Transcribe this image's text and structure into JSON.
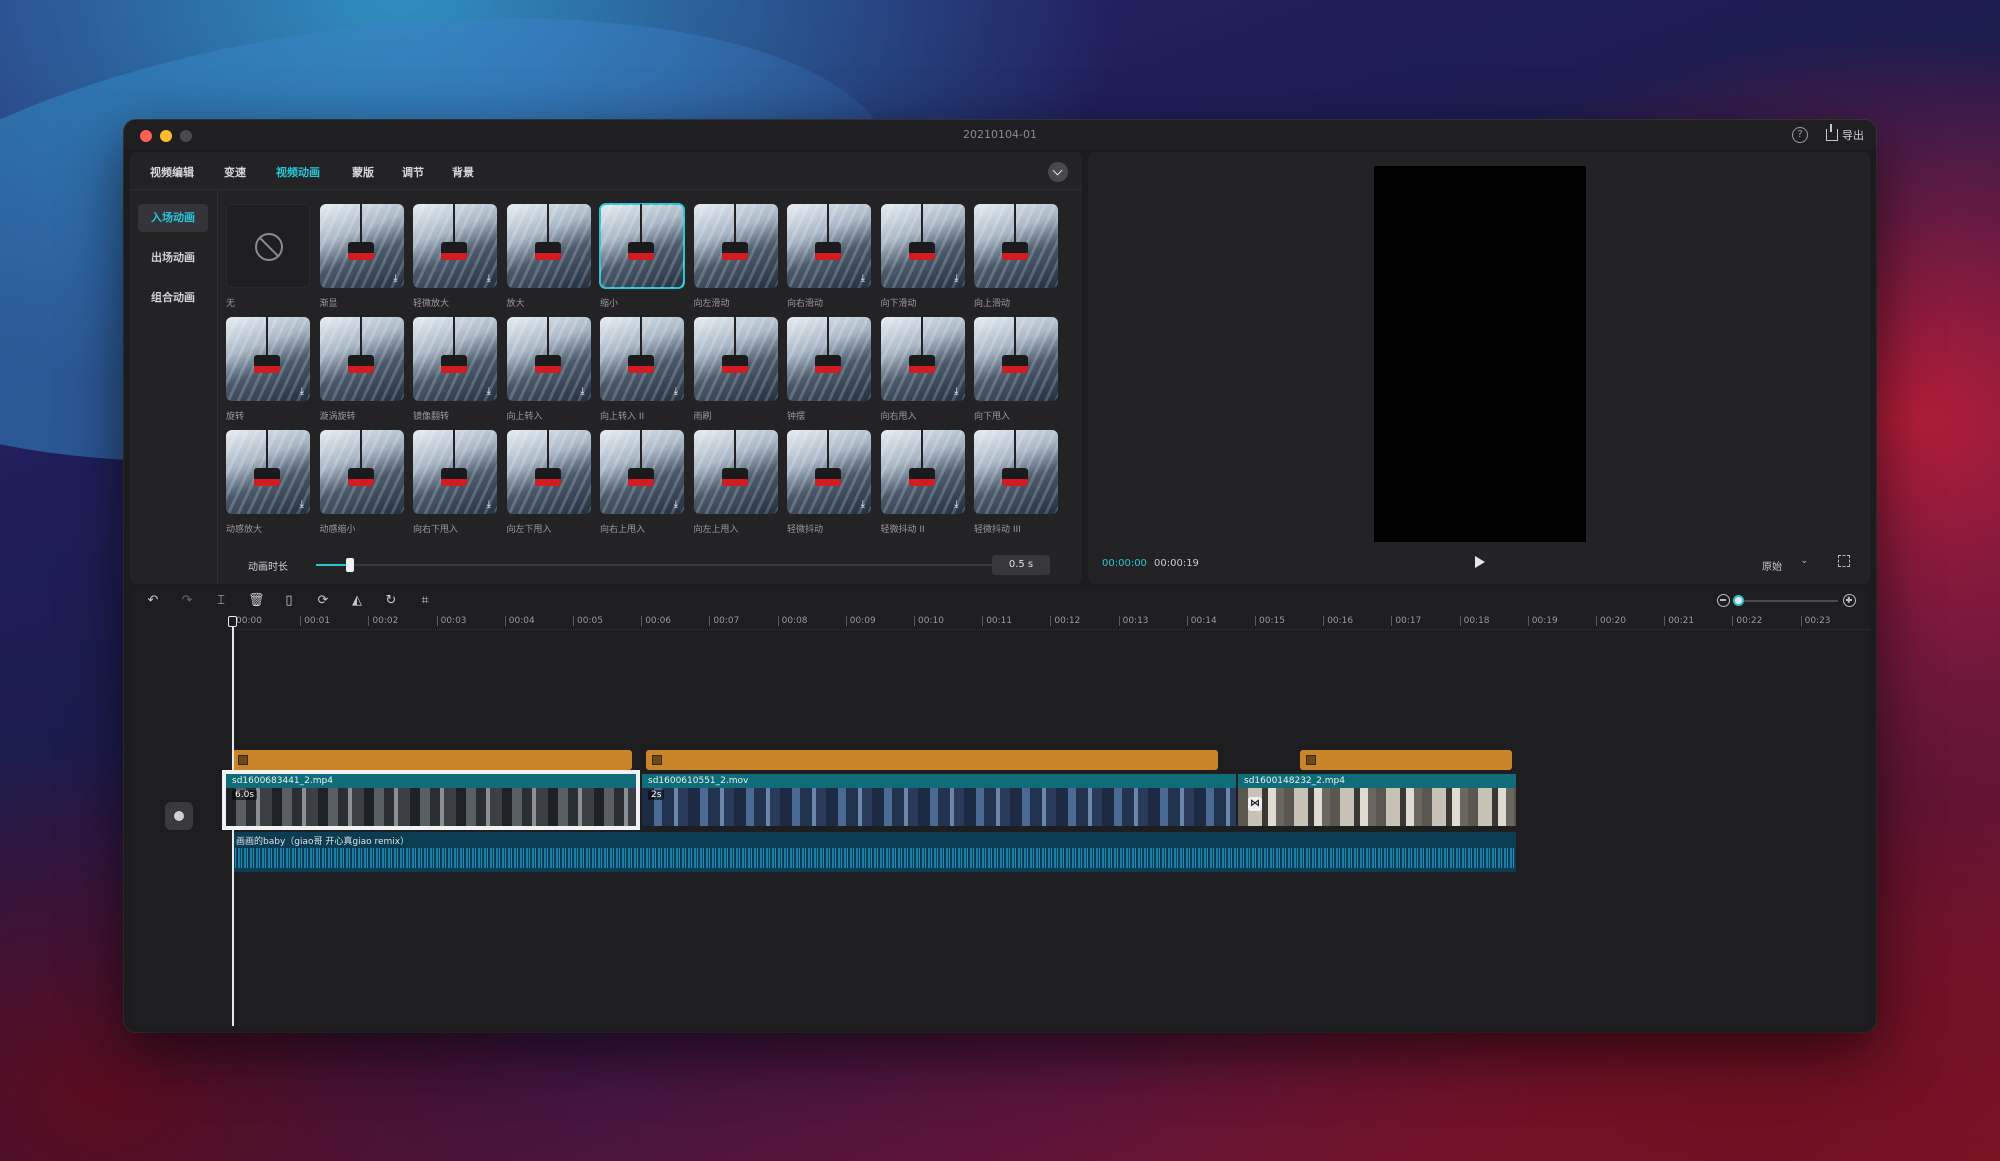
{
  "window": {
    "title": "20210104-01"
  },
  "header": {
    "help_icon": "?",
    "export_label": "导出"
  },
  "tabs": [
    {
      "label": "视频编辑",
      "active": false
    },
    {
      "label": "变速",
      "active": false
    },
    {
      "label": "视频动画",
      "active": true
    },
    {
      "label": "蒙版",
      "active": false
    },
    {
      "label": "调节",
      "active": false
    },
    {
      "label": "背景",
      "active": false
    }
  ],
  "subnav": [
    {
      "label": "入场动画",
      "active": true
    },
    {
      "label": "出场动画",
      "active": false
    },
    {
      "label": "组合动画",
      "active": false
    }
  ],
  "animations": [
    "无",
    "渐显",
    "轻微放大",
    "放大",
    "缩小",
    "向左滑动",
    "向右滑动",
    "向下滑动",
    "向上滑动",
    "旋转",
    "漩涡旋转",
    "镜像翻转",
    "向上转入",
    "向上转入 II",
    "雨刷",
    "钟摆",
    "向右甩入",
    "向下甩入",
    "动感放大",
    "动感缩小",
    "向右下甩入",
    "向左下甩入",
    "向右上甩入",
    "向左上甩入",
    "轻微抖动",
    "轻微抖动 II",
    "轻微抖动 III"
  ],
  "selected_animation": "缩小",
  "duration": {
    "label": "动画时长",
    "value": "0.5 s",
    "level": 0.05
  },
  "player": {
    "current_time": "00:00:00",
    "total_time": "00:00:19",
    "ratio_label": "原始"
  },
  "timeline": {
    "ruler": [
      "00:00",
      "00:01",
      "00:02",
      "00:03",
      "00:04",
      "00:05",
      "00:06",
      "00:07",
      "00:08",
      "00:09",
      "00:10",
      "00:11",
      "00:12",
      "00:13",
      "00:14",
      "00:15",
      "00:16",
      "00:17",
      "00:18",
      "00:19",
      "00:20",
      "00:21",
      "00:22",
      "00:23"
    ],
    "zoom_level": 0.0,
    "clips": [
      {
        "name": "sd1600683441_2.mp4",
        "duration": "6.0s"
      },
      {
        "name": "sd1600610551_2.mov",
        "duration": "2s"
      },
      {
        "name": "sd1600148232_2.mp4",
        "duration": ""
      }
    ],
    "audio_name": "画画的baby（giao哥 开心真giao remix）"
  },
  "colors": {
    "accent": "#29c5d6",
    "effect_bar": "#c98328",
    "clip": "#0e6d78",
    "audio": "#0b3c52"
  }
}
